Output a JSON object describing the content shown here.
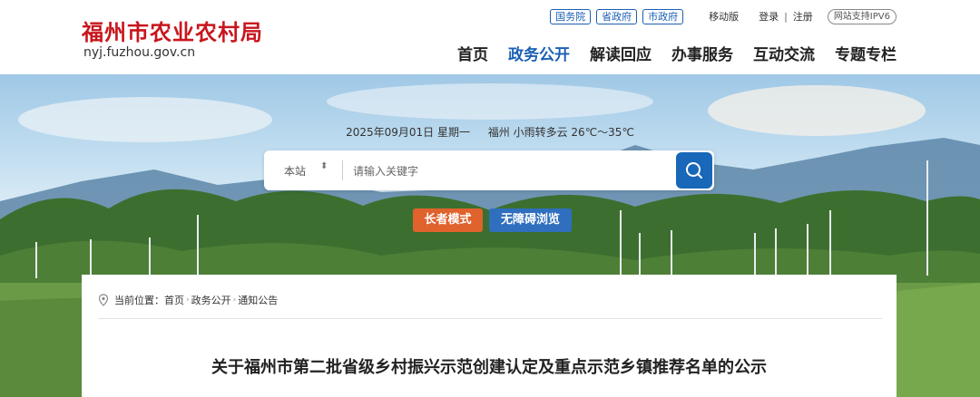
{
  "header": {
    "site_name": "福州市农业农村局",
    "domain": "nyj.fuzhou.gov.cn",
    "top_links": [
      "国务院",
      "省政府",
      "市政府"
    ],
    "mobile": "移动版",
    "login": "登录",
    "separator": "|",
    "register": "注册",
    "ipv6": "网站支持IPV6",
    "nav": [
      {
        "label": "首页",
        "active": false
      },
      {
        "label": "政务公开",
        "active": true
      },
      {
        "label": "解读回应",
        "active": false
      },
      {
        "label": "办事服务",
        "active": false
      },
      {
        "label": "互动交流",
        "active": false
      },
      {
        "label": "专题专栏",
        "active": false
      }
    ]
  },
  "hero": {
    "date": "2025年09月01日 星期一",
    "weather": "福州 小雨转多云 26℃～35℃",
    "search": {
      "scope": "本站",
      "placeholder": "请输入关键字",
      "icon": "search-icon"
    },
    "elder_mode": "长者模式",
    "accessible": "无障碍浏览"
  },
  "content": {
    "breadcrumb_prefix": "当前位置：",
    "breadcrumb": [
      "首页",
      "政务公开",
      "通知公告"
    ],
    "title": "关于福州市第二批省级乡村振兴示范创建认定及重点示范乡镇推荐名单的公示"
  },
  "colors": {
    "brand_red": "#c8161d",
    "accent_blue": "#1a5fb4",
    "elder_orange": "#e0622d"
  }
}
